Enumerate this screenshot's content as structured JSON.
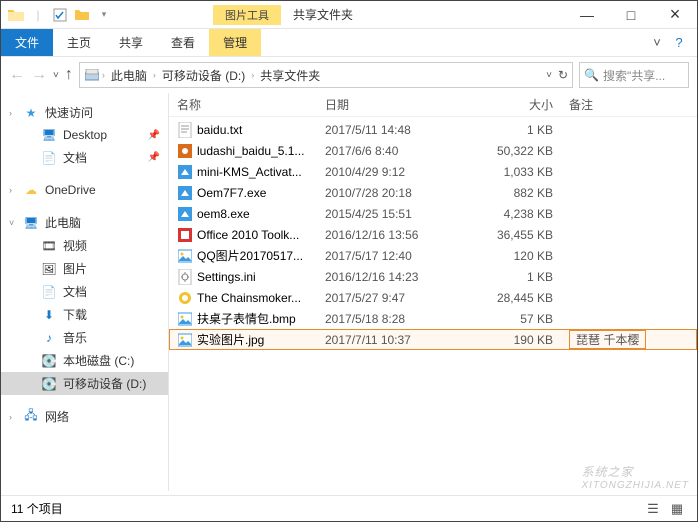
{
  "window": {
    "tool_context_label": "图片工具",
    "tool_context_title": "共享文件夹",
    "min": "—",
    "max": "□",
    "close": "×"
  },
  "ribbon": {
    "file": "文件",
    "home": "主页",
    "share": "共享",
    "view": "查看",
    "manage": "管理"
  },
  "address": {
    "root": "此电脑",
    "drive": "可移动设备 (D:)",
    "folder": "共享文件夹"
  },
  "search": {
    "placeholder": "搜索\"共享..."
  },
  "sidebar": {
    "quick": "快速访问",
    "desktop": "Desktop",
    "docs": "文档",
    "onedrive": "OneDrive",
    "thispc": "此电脑",
    "videos": "视频",
    "pictures": "图片",
    "docs2": "文档",
    "downloads": "下载",
    "music": "音乐",
    "cdrive": "本地磁盘 (C:)",
    "ddrive": "可移动设备 (D:)",
    "network": "网络"
  },
  "columns": {
    "name": "名称",
    "date": "日期",
    "size": "大小",
    "note": "备注"
  },
  "files": [
    {
      "icon": "txt",
      "name": "baidu.txt",
      "date": "2017/5/11 14:48",
      "size": "1 KB",
      "note": ""
    },
    {
      "icon": "exe",
      "name": "ludashi_baidu_5.1...",
      "date": "2017/6/6 8:40",
      "size": "50,322 KB",
      "note": ""
    },
    {
      "icon": "exe2",
      "name": "mini-KMS_Activat...",
      "date": "2010/4/29 9:12",
      "size": "1,033 KB",
      "note": ""
    },
    {
      "icon": "exe2",
      "name": "Oem7F7.exe",
      "date": "2010/7/28 20:18",
      "size": "882 KB",
      "note": ""
    },
    {
      "icon": "exe2",
      "name": "oem8.exe",
      "date": "2015/4/25 15:51",
      "size": "4,238 KB",
      "note": ""
    },
    {
      "icon": "exe3",
      "name": "Office 2010 Toolk...",
      "date": "2016/12/16 13:56",
      "size": "36,455 KB",
      "note": ""
    },
    {
      "icon": "img",
      "name": "QQ图片20170517...",
      "date": "2017/5/17 12:40",
      "size": "120 KB",
      "note": ""
    },
    {
      "icon": "ini",
      "name": "Settings.ini",
      "date": "2016/12/16 14:23",
      "size": "1 KB",
      "note": ""
    },
    {
      "icon": "exe4",
      "name": "The Chainsmoker...",
      "date": "2017/5/27 9:47",
      "size": "28,445 KB",
      "note": ""
    },
    {
      "icon": "img",
      "name": "扶桌子表情包.bmp",
      "date": "2017/5/18 8:28",
      "size": "57 KB",
      "note": ""
    },
    {
      "icon": "img",
      "name": "实验图片.jpg",
      "date": "2017/7/11 10:37",
      "size": "190 KB",
      "note": "琵琶 千本樱",
      "selected": true
    }
  ],
  "status": {
    "count": "11 个项目"
  },
  "watermark": {
    "main": "系统之家",
    "sub": "XITONGZHIJIA.NET"
  }
}
